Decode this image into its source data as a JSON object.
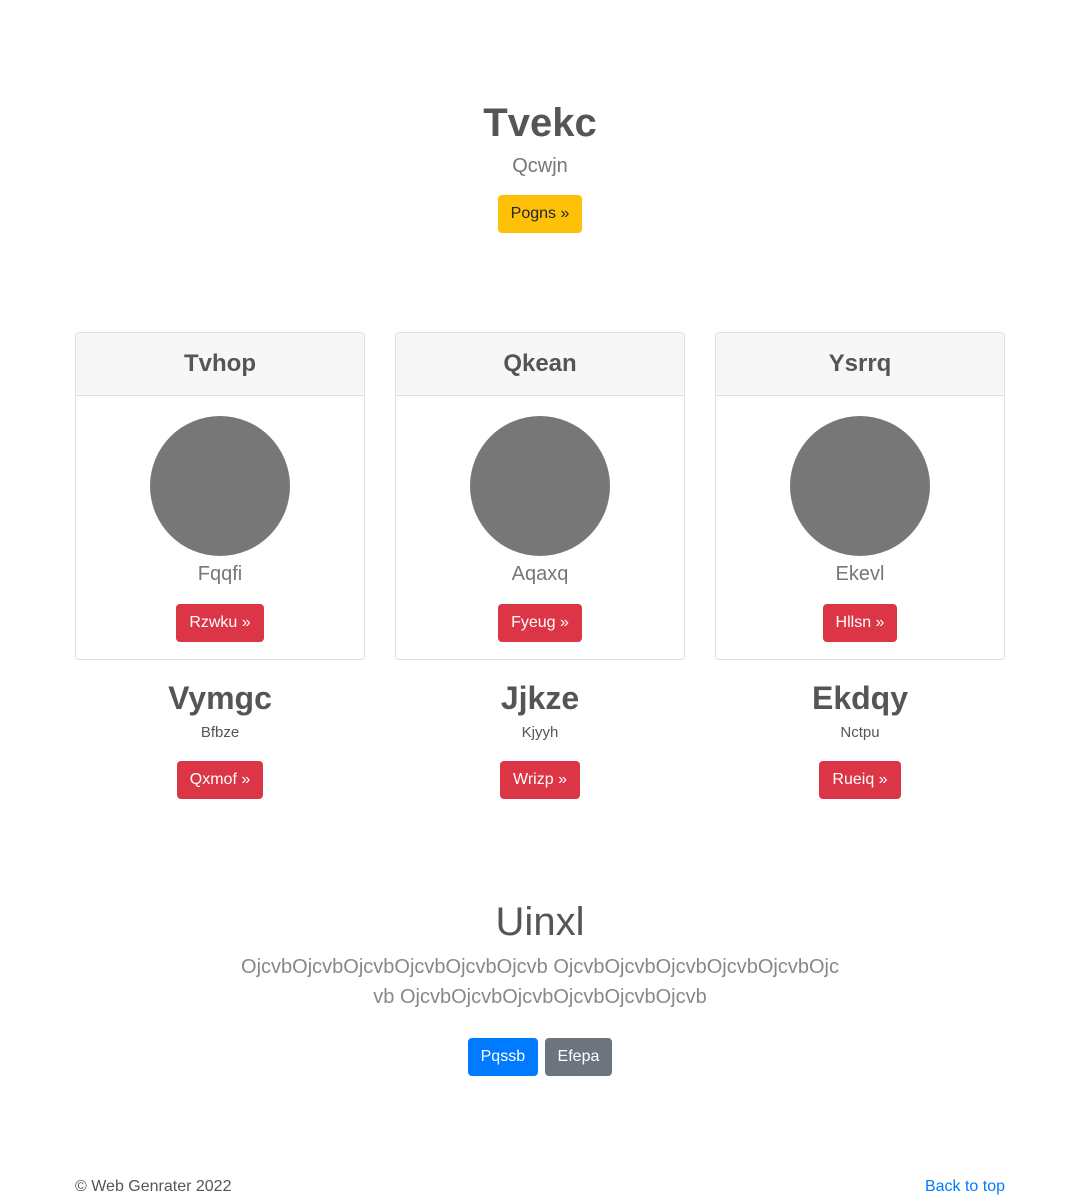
{
  "hero": {
    "title": "Tvekc",
    "subtitle": "Qcwjn",
    "button_label": "Pogns »"
  },
  "cards": [
    {
      "header": "Tvhop",
      "caption": "Fqqfi",
      "card_button": "Rzwku »",
      "title": "Vymgc",
      "text": "Bfbze",
      "button": "Qxmof »"
    },
    {
      "header": "Qkean",
      "caption": "Aqaxq",
      "card_button": "Fyeug »",
      "title": "Jjkze",
      "text": "Kjyyh",
      "button": "Wrizp »"
    },
    {
      "header": "Ysrrq",
      "caption": "Ekevl",
      "card_button": "Hllsn »",
      "title": "Ekdqy",
      "text": "Nctpu",
      "button": "Rueiq »"
    }
  ],
  "promo": {
    "title": "Uinxl",
    "lead": "OjcvbOjcvbOjcvbOjcvbOjcvbOjcvb OjcvbOjcvbOjcvbOjcvbOjcvbOjcvb OjcvbOjcvbOjcvbOjcvbOjcvbOjcvb",
    "primary_button": "Pqssb",
    "secondary_button": "Efepa"
  },
  "footer": {
    "copyright": "© Web Genrater 2022",
    "back_to_top": "Back to top"
  },
  "colors": {
    "warning": "#ffc107",
    "danger": "#dc3545",
    "primary": "#007bff",
    "secondary": "#6c757d",
    "avatar": "#777777"
  }
}
